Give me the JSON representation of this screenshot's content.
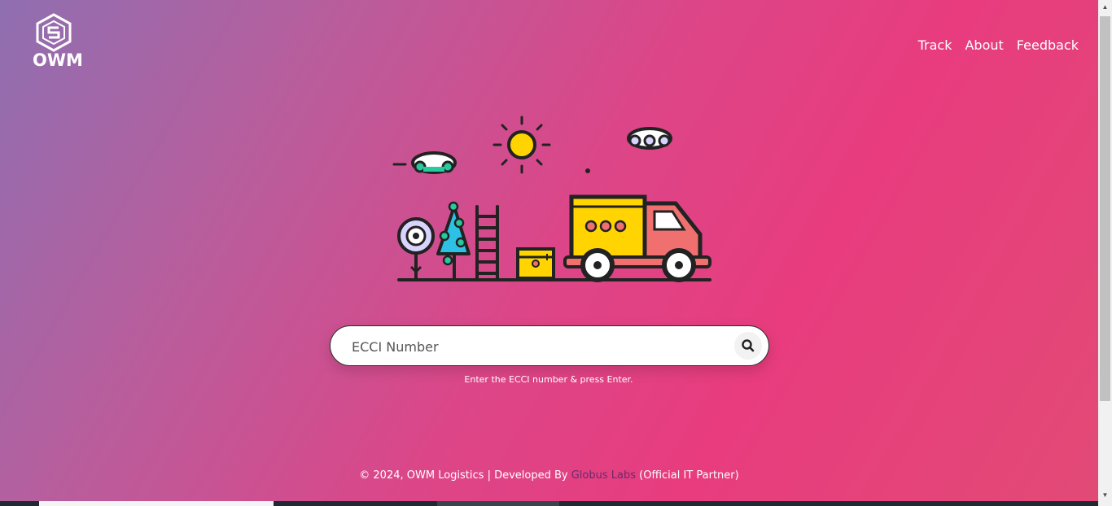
{
  "brand": {
    "logo_text": "OWM",
    "logo_icon": "owm-hexagon-logo-icon"
  },
  "nav": {
    "items": [
      "Track",
      "About",
      "Feedback"
    ]
  },
  "search": {
    "placeholder": "ECCI Number",
    "value": "",
    "icon": "search-icon"
  },
  "hint": "Enter the ECCI number & press Enter.",
  "footer": {
    "prefix": "© 2024, OWM Logistics | Developed By ",
    "brand_link": "Globus Labs",
    "suffix": " (Official IT Partner)"
  },
  "colors": {
    "gradient_start": "#8f6fb1",
    "gradient_end": "#e83c7e",
    "truck_yellow": "#ffd400",
    "truck_cab": "#f07070",
    "footer_link": "#6d2a6a"
  }
}
